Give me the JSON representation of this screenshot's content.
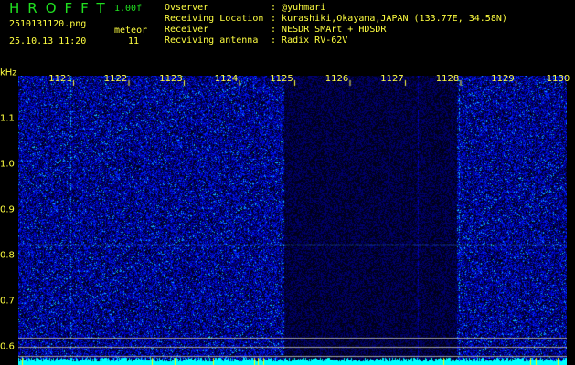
{
  "app": {
    "title": "HROFFT",
    "version": "1.00f"
  },
  "file": {
    "name": "2510131120.png",
    "datetime": "25.10.13 11:20"
  },
  "meteor": {
    "label": "meteor",
    "count": "11"
  },
  "info": [
    {
      "label": "Ovserver",
      "value": "@yuhmari"
    },
    {
      "label": "Receiving Location",
      "value": "kurashiki,Okayama,JAPAN (133.77E, 34.58N)"
    },
    {
      "label": "Receiver",
      "value": "NESDR SMArt + HDSDR"
    },
    {
      "label": "Recviving antenna",
      "value": "Radix RV-62V"
    }
  ],
  "axis": {
    "y_unit": "kHz",
    "x_labels": [
      "1121",
      "1122",
      "1123",
      "1124",
      "1125",
      "1126",
      "1127",
      "1128",
      "1129",
      "1130"
    ],
    "y_labels": [
      "1.1",
      "1.0",
      "0.9",
      "0.8",
      "0.7",
      "0.6"
    ]
  },
  "colors": {
    "text": "#ffff40",
    "title": "#20e020",
    "level": "#00ffff"
  }
}
